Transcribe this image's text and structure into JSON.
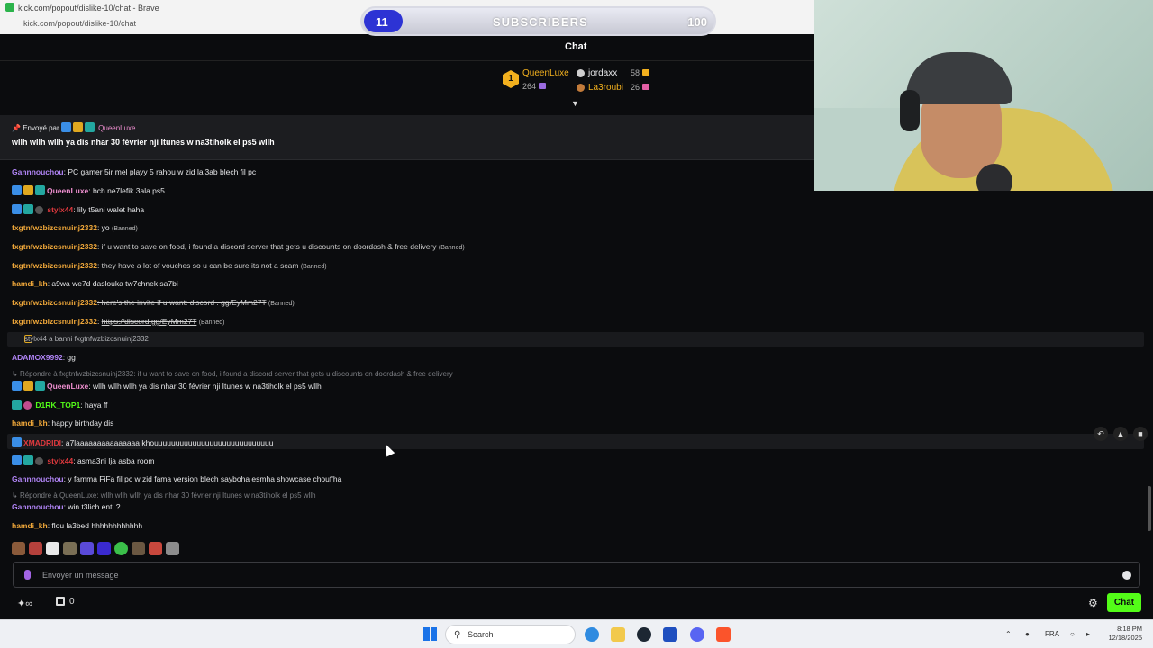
{
  "browser": {
    "title": "kick.com/popout/dislike-10/chat - Brave",
    "url": "kick.com/popout/dislike-10/chat"
  },
  "subscribers_bar": {
    "current": "11",
    "label": "SUBSCRIBERS",
    "goal": "100",
    "progress_fraction": 0.11,
    "color": "#2d33d4"
  },
  "chat": {
    "title": "Chat",
    "leaderboard": [
      {
        "rank": "1",
        "user": "QueenLuxe",
        "value": "264"
      },
      {
        "user": "jordaxx",
        "value": "58"
      },
      {
        "user": "La3roubi",
        "value": "26"
      }
    ],
    "pinned": {
      "sent_by_label": "Envoyé par",
      "user": "QueenLuxe",
      "text": "wllh wllh wllh ya dis nhar 30 février nji Itunes w na3tiholk el ps5 wllh"
    },
    "messages": [
      {
        "user": "Gannnouchou",
        "text": ": PC gamer 5ir mel playy 5 rahou w zid lal3ab blech fil pc"
      },
      {
        "user": "QueenLuxe",
        "text": ": bch ne7lefik 3ala ps5"
      },
      {
        "user": "stylx44",
        "text": ": lily t5ani walet haha"
      },
      {
        "user": "fxgtnfwzbizcsnuinj2332",
        "text": ": yo",
        "banned": "(Banned)"
      },
      {
        "user": "fxgtnfwzbizcsnuinj2332",
        "text": ": if u want to save on food, i found a discord server that gets u discounts on doordash & free delivery",
        "banned": "(Banned)"
      },
      {
        "user": "fxgtnfwzbizcsnuinj2332",
        "text": ": they have a lot of vouches so u can be sure its not a scam",
        "banned": "(Banned)"
      },
      {
        "user": "hamdi_kh",
        "text": ": a9wa we7d daslouka tw7chnek sa7bi"
      },
      {
        "user": "fxgtnfwzbizcsnuinj2332",
        "text": ": here's the invite if u want: discord . gg/EyMm27T",
        "banned": "(Banned)"
      },
      {
        "user": "fxgtnfwzbizcsnuinj2332",
        "text": "https://discord.gg/EyMm27T",
        "sep": ": ",
        "banned": "(Banned)"
      },
      {
        "system": "stylx44 a banni fxgtnfwzbizcsnuinj2332"
      },
      {
        "user": "ADAMOX9992",
        "text": ": gg"
      },
      {
        "reply": "Répondre à fxgtnfwzbizcsnuinj2332: if u want to save on food, i found a discord server that gets u discounts on doordash & free delivery"
      },
      {
        "user": "QueenLuxe",
        "text": ": wllh wllh wllh ya dis nhar 30 février nji Itunes w na3tiholk el ps5 wllh"
      },
      {
        "user": "D1RK_TOP1",
        "text": ": haya ff"
      },
      {
        "user": "hamdi_kh",
        "text": ": happy birthday dis"
      },
      {
        "user": "XMADRIDI",
        "text": ": a7laaaaaaaaaaaaaaa khouuuuuuuuuuuuuuuuuuuuuuuuuuuu"
      },
      {
        "user": "stylx44",
        "text": ": asma3ni lja asba room"
      },
      {
        "user": "Gannnouchou",
        "text": ": y famma FiFa fil pc w zid fama version blech sayboha esmha showcase chouf'ha"
      },
      {
        "reply": "Répondre à QueenLuxe: wllh wllh wllh ya dis nhar 30 février nji Itunes w na3tiholk el ps5 wllh"
      },
      {
        "user": "Gannnouchou",
        "text": ": win t3lich enti ?"
      },
      {
        "user": "hamdi_kh",
        "text": ": flou la3bed hhhhhhhhhhhh"
      }
    ],
    "input_placeholder": "Envoyer un message",
    "points_count": "0",
    "chat_button": "Chat"
  },
  "taskbar": {
    "search_label": "Search",
    "language": "FRA",
    "time": "8:18 PM",
    "date": "12/18/2025"
  },
  "colors": {
    "accent": "#53fc18",
    "user_purple": "#b084f5",
    "user_pink": "#ee8ecf",
    "user_orange": "#f0a83a",
    "user_red": "#e0393e",
    "user_green": "#53fc18"
  }
}
